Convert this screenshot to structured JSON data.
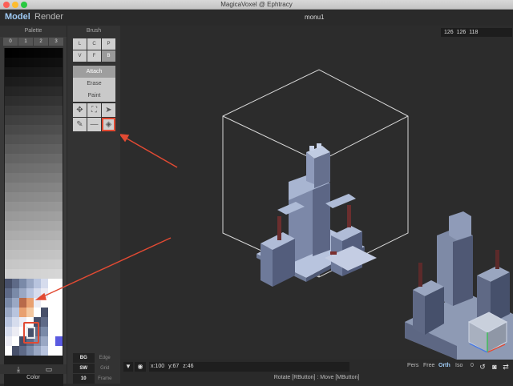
{
  "window": {
    "title": "MagicaVoxel @ Ephtracy"
  },
  "modes": {
    "model": "Model",
    "render": "Render"
  },
  "file": {
    "name": "monu1"
  },
  "palette": {
    "header": "Palette",
    "tabs": [
      "0",
      "1",
      "2",
      "3"
    ],
    "footer_label": "Color",
    "import_icon": "download-icon",
    "open_icon": "folder-icon"
  },
  "brush": {
    "header": "Brush",
    "types": [
      "L",
      "C",
      "P",
      "V",
      "F",
      "B"
    ],
    "active_type": "B",
    "actions": [
      "Attach",
      "Erase",
      "Paint"
    ],
    "active_action": "Attach",
    "tools": [
      "move-icon",
      "select-icon",
      "cursor-icon",
      "picker-icon",
      "line-icon",
      "fill-icon"
    ],
    "options": [
      {
        "key": "BG",
        "value": "Edge"
      },
      {
        "key": "SW",
        "value": "Grid"
      },
      {
        "key": "10",
        "value": "Frame"
      }
    ]
  },
  "viewport": {
    "size_readout": "126 126 118"
  },
  "statusbar": {
    "position": "x:100  y:67  z:46",
    "views": [
      "Pers",
      "Free",
      "Orth",
      "Iso"
    ],
    "active_view": "Orth",
    "zoom": "0",
    "hint": "Rotate [RButton] : Move [MButton]"
  },
  "colors": {
    "accent": "#9ec9f3",
    "highlight": "#e24a33",
    "model_main": "#a4b3d1",
    "model_dark": "#5e6a87"
  }
}
